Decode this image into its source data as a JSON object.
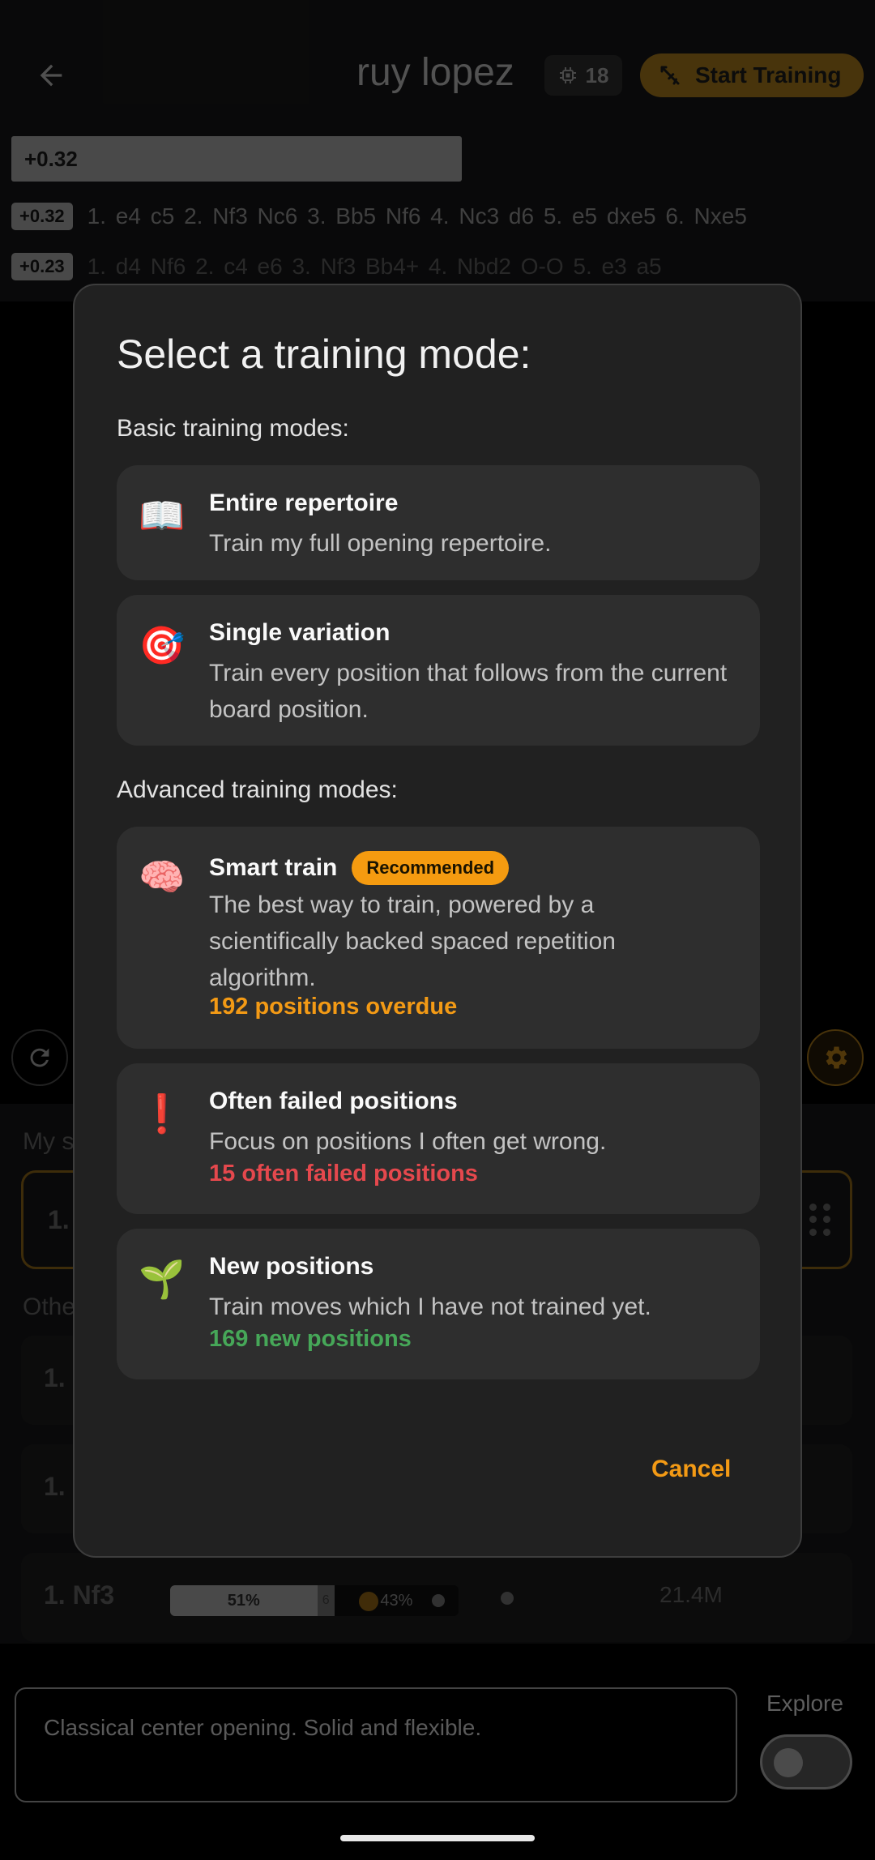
{
  "header": {
    "title": "ruy lopez",
    "engine_depth": "18",
    "start_training_label": "Start Training"
  },
  "lines": {
    "top_eval": "+0.32",
    "line1_eval": "+0.32",
    "line1_moves": "1. e4 c5  2. Nf3 Nc6  3. Bb5 Nf6  4. Nc3 d6  5. e5 dxe5  6. Nxe5",
    "line2_eval": "+0.23",
    "line2_moves": "1. d4 Nf6  2. c4 e6  3. Nf3 Bb4+  4. Nbd2 O-O  5. e3 a5"
  },
  "lower": {
    "my_label": "My s",
    "my_line": "1.",
    "other_label": "Othe",
    "row1_move": "1.",
    "row2_move": "1.",
    "row3_move": "1. Nf3",
    "row3_white_pct": "51%",
    "row3_white_fraction": 0.51,
    "row3_draw_pct": "6",
    "row3_draw_fraction": 0.06,
    "row3_black_pct": "43%",
    "row3_black_fraction": 0.43,
    "row3_games": "21.4M"
  },
  "bottom": {
    "notes": "Classical center opening. Solid and flexible.",
    "explore_label": "Explore"
  },
  "modal": {
    "title": "Select a training mode:",
    "basic_label": "Basic training modes:",
    "advanced_label": "Advanced training modes:",
    "options": [
      {
        "icon": "📖",
        "icon_name": "open-book-icon",
        "title": "Entire repertoire",
        "desc": "Train my full opening repertoire."
      },
      {
        "icon": "🎯",
        "icon_name": "target-icon",
        "title": "Single variation",
        "desc": "Train every position that follows from the current board position."
      },
      {
        "icon": "🧠",
        "icon_name": "brain-icon",
        "title": "Smart train",
        "badge": "Recommended",
        "desc": "The best way to train, powered by a scientifically backed spaced repetition algorithm.",
        "stat": "192 positions overdue",
        "stat_color": "#f39a15"
      },
      {
        "icon": "❗",
        "icon_name": "exclamation-icon",
        "title": "Often failed positions",
        "desc": "Focus on positions I often get wrong.",
        "stat": "15 often failed positions",
        "stat_color": "#e5484d"
      },
      {
        "icon": "🌱",
        "icon_name": "seedling-icon",
        "title": "New positions",
        "desc": "Train moves which I have not trained yet.",
        "stat": "169 new positions",
        "stat_color": "#46a758"
      }
    ],
    "cancel_label": "Cancel"
  },
  "colors": {
    "accent": "#f39a15",
    "modal_bg": "#212121",
    "option_bg": "#2e2e2e"
  }
}
